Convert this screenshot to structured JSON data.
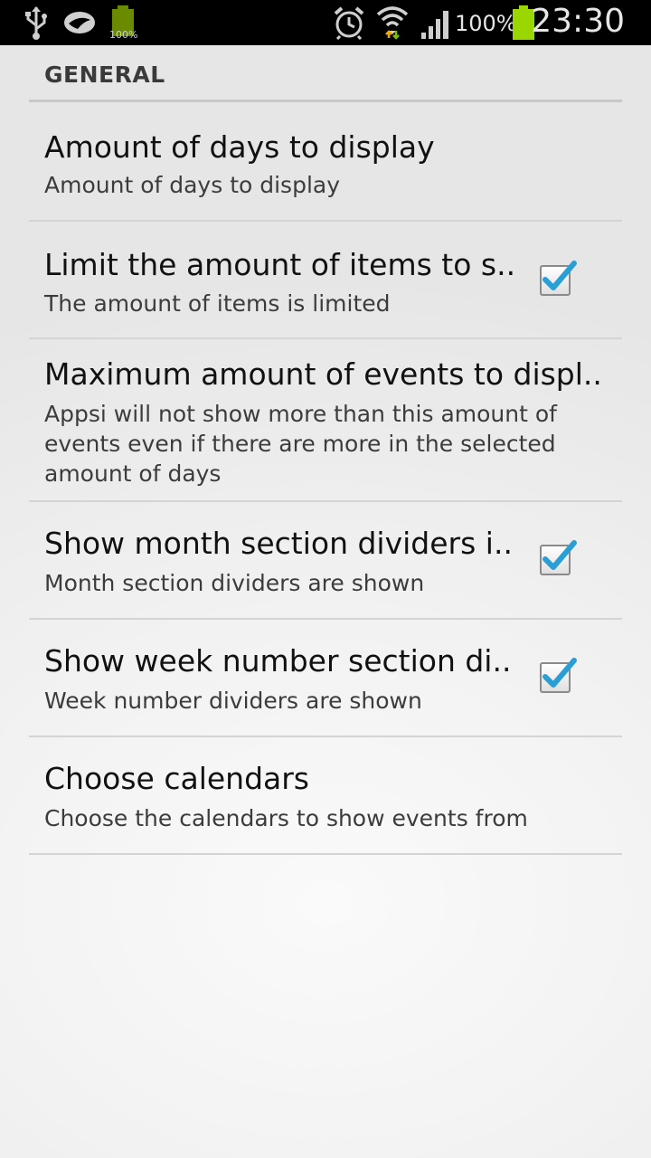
{
  "status_bar": {
    "battery_mini_label": "100%",
    "battery_percent": "100%",
    "clock": "23:30",
    "icons": [
      "usb-icon",
      "notification-app-icon",
      "battery-small-icon",
      "alarm-icon",
      "wifi-icon",
      "signal-icon",
      "battery-icon"
    ]
  },
  "section": {
    "title": "GENERAL"
  },
  "preferences": [
    {
      "title": "Amount of days to display",
      "summary": "Amount of days to display",
      "has_checkbox": false
    },
    {
      "title": "Limit the amount of items to s..",
      "summary": "The amount of items is limited",
      "has_checkbox": true,
      "checked": true
    },
    {
      "title": "Maximum amount of events to displ..",
      "summary_lines": [
        "Appsi will not show more than this amount of",
        "events even if there are more in the selected",
        "amount of days"
      ],
      "has_checkbox": false
    },
    {
      "title": "Show month section dividers i..",
      "summary": "Month section dividers are shown",
      "has_checkbox": true,
      "checked": true
    },
    {
      "title": "Show week number section di..",
      "summary": "Week number dividers are shown",
      "has_checkbox": true,
      "checked": true
    },
    {
      "title": "Choose calendars",
      "summary": "Choose the calendars to show events from",
      "has_checkbox": false
    }
  ],
  "colors": {
    "checkmark": "#2a9fd6",
    "status_bar_bg": "#000000",
    "battery_green": "#9ad600"
  }
}
